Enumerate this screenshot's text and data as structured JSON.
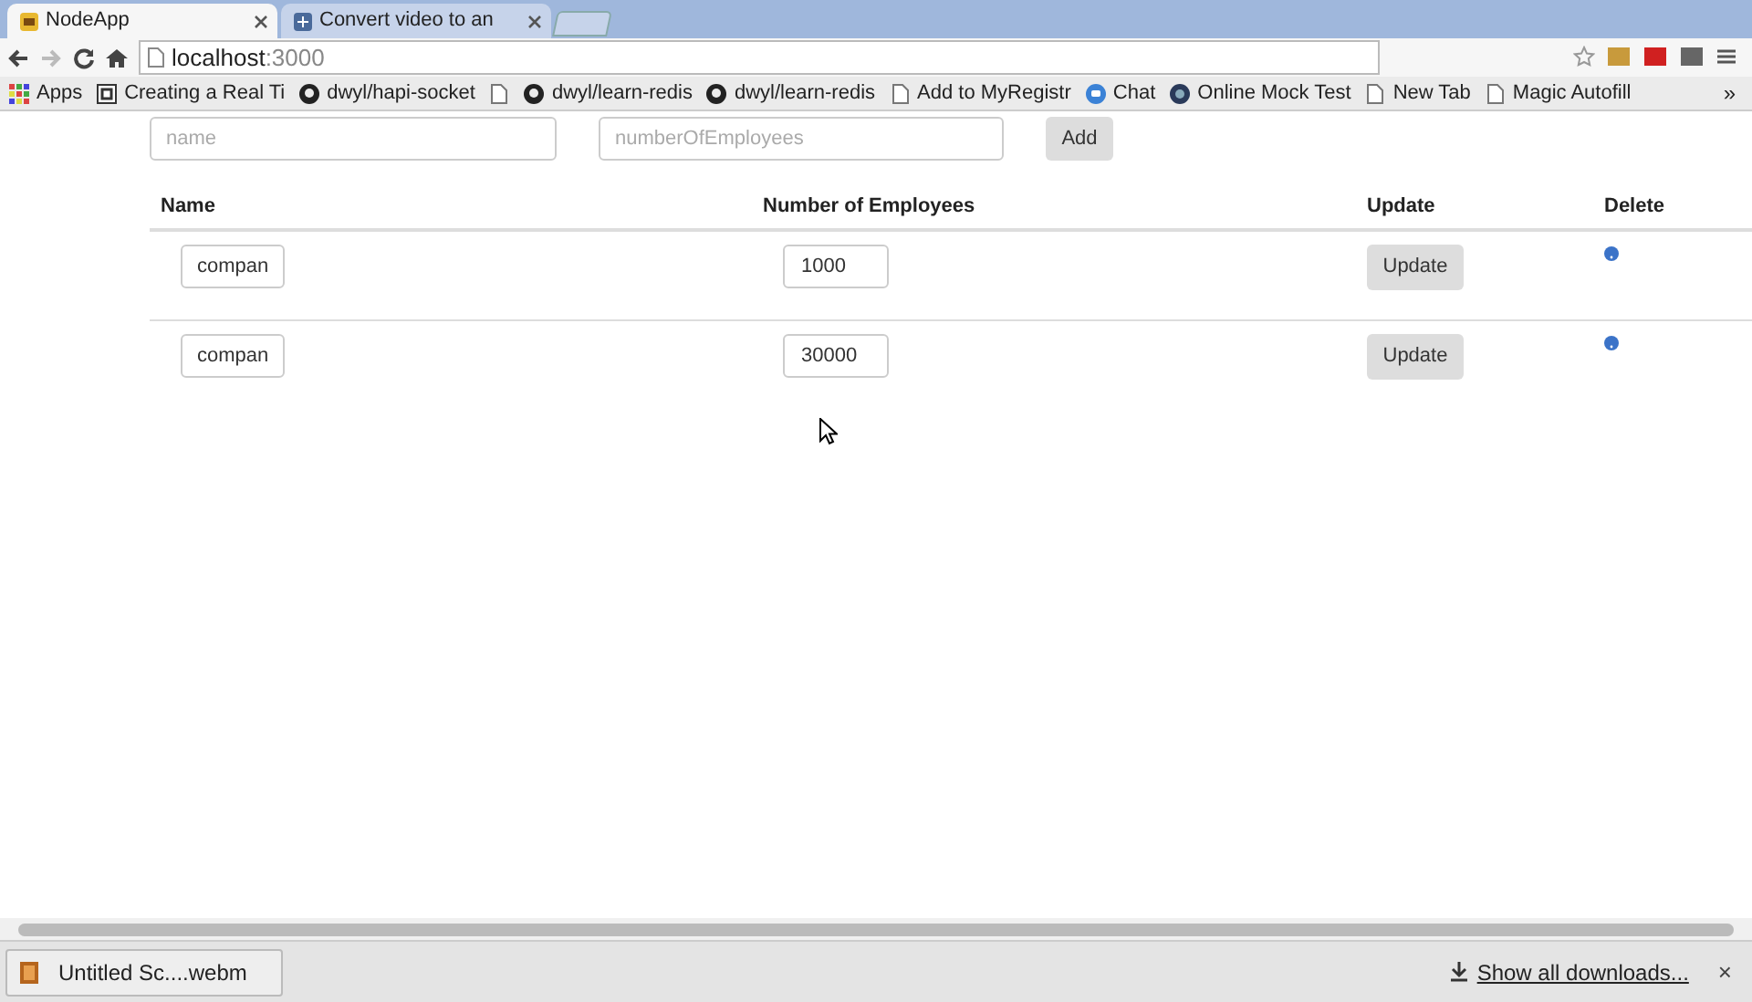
{
  "tabs": [
    {
      "title": "NodeApp",
      "selected": true,
      "kind": "app"
    },
    {
      "title": "Convert video to an",
      "selected": false,
      "kind": "convert"
    }
  ],
  "address": {
    "host": "localhost",
    "port": ":3000"
  },
  "bookmarks": [
    {
      "label": "Apps",
      "kind": "apps"
    },
    {
      "label": "Creating a Real Ti",
      "kind": "box"
    },
    {
      "label": "dwyl/hapi-socket",
      "kind": "github"
    },
    {
      "kind": "page"
    },
    {
      "label": "dwyl/learn-redis",
      "kind": "github"
    },
    {
      "label": "dwyl/learn-redis",
      "kind": "github"
    },
    {
      "label": "Add to MyRegistr",
      "kind": "page"
    },
    {
      "label": "Chat",
      "kind": "chat"
    },
    {
      "label": "Online Mock Test",
      "kind": "globe"
    },
    {
      "label": "New Tab",
      "kind": "page"
    },
    {
      "label": "Magic Autofill",
      "kind": "page"
    }
  ],
  "bookmarks_more": "»",
  "form": {
    "name_placeholder": "name",
    "employees_placeholder": "numberOfEmployees",
    "add_button": "Add"
  },
  "table": {
    "columns": [
      "Name",
      "Number of Employees",
      "Update",
      "Delete"
    ],
    "rows": [
      {
        "name": "compan",
        "employees": "1000",
        "update": "Update"
      },
      {
        "name": "compan",
        "employees": "30000",
        "update": "Update"
      }
    ]
  },
  "downloads": {
    "file": "Untitled Sc....webm",
    "show_all": "Show all downloads...",
    "close": "×"
  }
}
